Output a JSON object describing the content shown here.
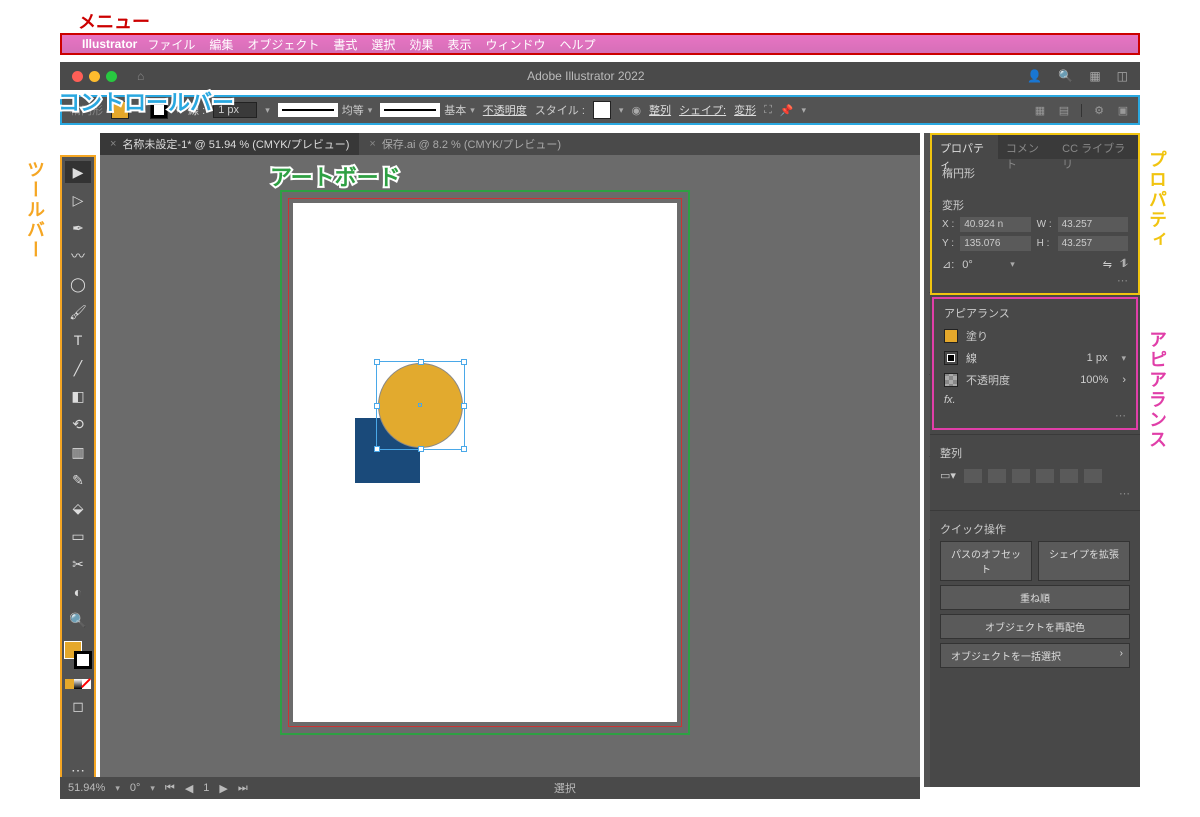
{
  "annotations": {
    "menu": "メニュー",
    "control": "コントロールバー",
    "toolbar": "ツールバー",
    "artboard": "アートボード",
    "properties": "プロパティ",
    "appearance": "アピアランス"
  },
  "menu": {
    "app": "Illustrator",
    "items": [
      "ファイル",
      "編集",
      "オブジェクト",
      "書式",
      "選択",
      "効果",
      "表示",
      "ウィンドウ",
      "ヘルプ"
    ]
  },
  "titlebar": {
    "title": "Adobe Illustrator 2022"
  },
  "control": {
    "seltype": "楕円形",
    "stroke_label": "線 :",
    "stroke_w": "1 px",
    "profile": "均等",
    "brush": "基本",
    "opacity": "不透明度",
    "style": "スタイル :",
    "align": "整列",
    "shape": "シェイプ:",
    "transform": "変形"
  },
  "tabs": [
    {
      "label": "名称未設定-1* @ 51.94 % (CMYK/プレビュー)",
      "active": true
    },
    {
      "label": "保存.ai @ 8.2 % (CMYK/プレビュー)",
      "active": false
    }
  ],
  "status": {
    "zoom": "51.94%",
    "rot": "0°",
    "page": "1",
    "mode": "選択"
  },
  "panel": {
    "tabs": [
      "プロパティ",
      "コメント",
      "CC ライブラリ"
    ],
    "shape": "楕円形",
    "transform_hd": "変形",
    "x_lbl": "X :",
    "y_lbl": "Y :",
    "w_lbl": "W :",
    "h_lbl": "H :",
    "x": "40.924 n",
    "y": "135.076",
    "w": "43.257",
    "h": "43.257",
    "rot": "0°",
    "appear_hd": "アピアランス",
    "fill": "塗り",
    "stroke": "線",
    "stroke_w": "1 px",
    "opacity_lbl": "不透明度",
    "opacity": "100%",
    "fx": "fx.",
    "align_hd": "整列",
    "quick_hd": "クイック操作",
    "btns": [
      "パスのオフセット",
      "シェイプを拡張",
      "重ね順",
      "オブジェクトを再配色",
      "オブジェクトを一括選択"
    ]
  }
}
